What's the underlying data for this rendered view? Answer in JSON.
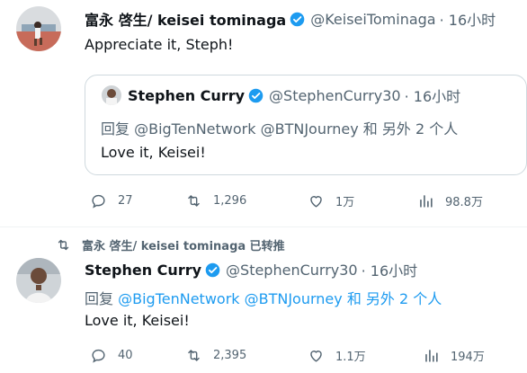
{
  "tweet1": {
    "author_name": "富永 啓生/ keisei tominaga",
    "handle": "@KeiseiTominaga",
    "time": "· 16小时",
    "text": "Appreciate it, Steph!",
    "quote": {
      "author_name": "Stephen Curry",
      "handle": "@StephenCurry30",
      "time": "· 16小时",
      "reply_prefix": "回复 @BigTenNetwork @BTNJourney 和 另外 2 个人",
      "text": "Love it, Keisei!"
    },
    "actions": {
      "replies": "27",
      "retweets": "1,296",
      "likes": "1万",
      "views": "98.8万"
    }
  },
  "retweet_banner": "富永 啓生/ keisei tominaga 已转推",
  "tweet2": {
    "author_name": "Stephen Curry",
    "handle": "@StephenCurry30",
    "time": "· 16小时",
    "reply_label": "回复",
    "reply_mentions": "@BigTenNetwork @BTNJourney 和 另外 2 个人",
    "text": "Love it, Keisei!",
    "actions": {
      "replies": "40",
      "retweets": "2,395",
      "likes": "1.1万",
      "views": "194万"
    }
  },
  "colors": {
    "accent": "#1d9bf0",
    "secondary": "#536471",
    "verified": "#1d9bf0"
  }
}
